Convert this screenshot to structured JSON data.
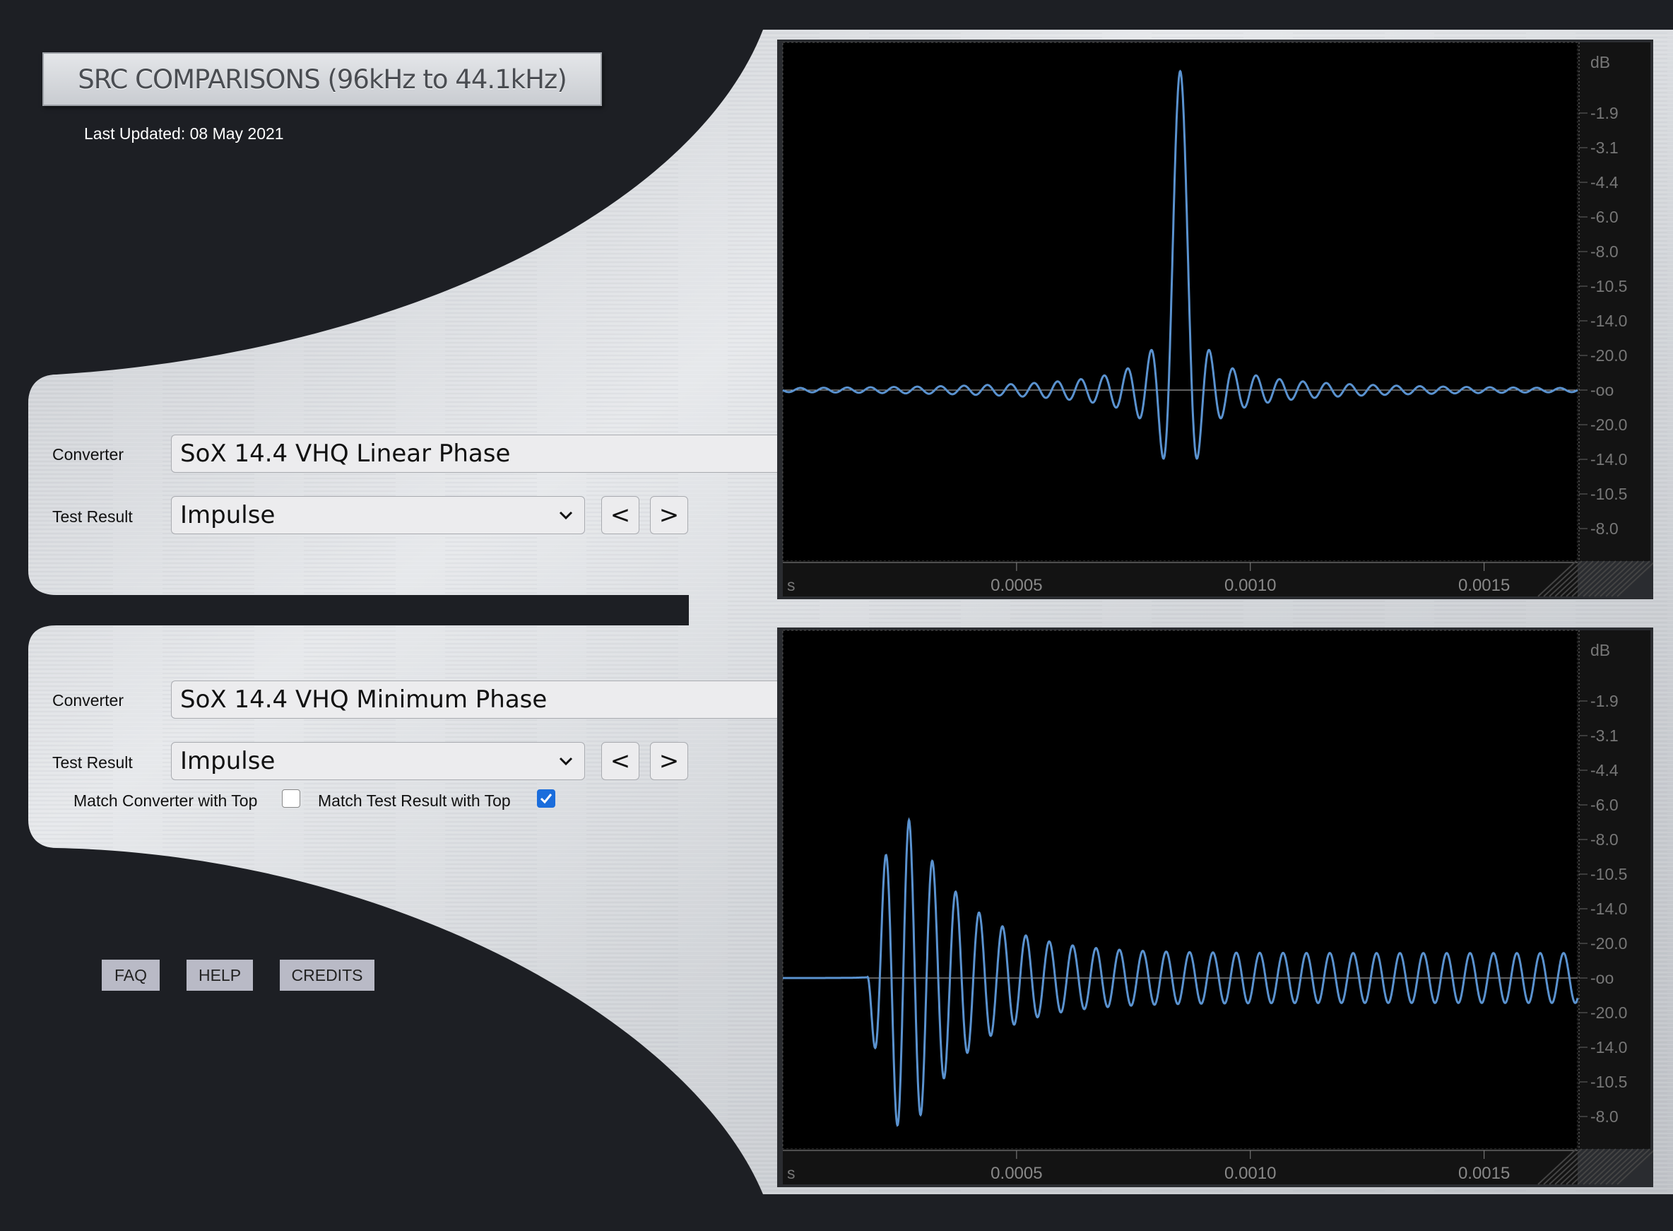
{
  "header": {
    "title": "SRC COMPARISONS (96kHz to 44.1kHz)",
    "last_updated": "Last Updated: 08 May 2021"
  },
  "top_panel": {
    "converter_label": "Converter",
    "converter_value": "SoX 14.4 VHQ Linear Phase",
    "test_result_label": "Test Result",
    "test_result_value": "Impulse",
    "prev_label": "<",
    "next_label": ">"
  },
  "bottom_panel": {
    "converter_label": "Converter",
    "converter_value": "SoX 14.4 VHQ Minimum Phase",
    "test_result_label": "Test Result",
    "test_result_value": "Impulse",
    "prev_label": "<",
    "next_label": ">",
    "match_converter_label": "Match Converter with Top",
    "match_converter_checked": false,
    "match_test_label": "Match Test Result with Top",
    "match_test_checked": true
  },
  "footer_buttons": {
    "faq": "FAQ",
    "help": "HELP",
    "credits": "CREDITS"
  },
  "colors": {
    "waveform": "#5a92cf",
    "plot_bg": "#000000",
    "accent_check": "#1a6ddc"
  },
  "chart_data": [
    {
      "type": "line",
      "name": "top",
      "x_unit": "s",
      "y_unit": "dB",
      "xlim": [
        0,
        0.0017
      ],
      "x_ticks": [
        "0.0005",
        "0.0010",
        "0.0015"
      ],
      "y_ticks": [
        "-1.9",
        "-3.1",
        "-4.4",
        "-6.0",
        "-8.0",
        "-10.5",
        "-14.0",
        "-20.0",
        "-oo",
        "-20.0",
        "-14.0",
        "-10.5",
        "-8.0"
      ],
      "waveform": "linear-phase impulse: symmetric sinc ringing",
      "peak_time": 0.00085,
      "peak_amplitude": 0.94,
      "first_sidelobe_amplitude": -0.21
    },
    {
      "type": "line",
      "name": "bottom",
      "x_unit": "s",
      "y_unit": "dB",
      "xlim": [
        0,
        0.0017
      ],
      "x_ticks": [
        "0.0005",
        "0.0010",
        "0.0015"
      ],
      "y_ticks": [
        "-1.9",
        "-3.1",
        "-4.4",
        "-6.0",
        "-8.0",
        "-10.5",
        "-14.0",
        "-20.0",
        "-oo",
        "-20.0",
        "-14.0",
        "-10.5",
        "-8.0"
      ],
      "waveform": "minimum-phase impulse: decaying post-ringing",
      "onset_time": 0.00018,
      "peak_time": 0.00027,
      "peak_amplitude": 0.49,
      "first_trough_amplitude": -0.33
    }
  ]
}
